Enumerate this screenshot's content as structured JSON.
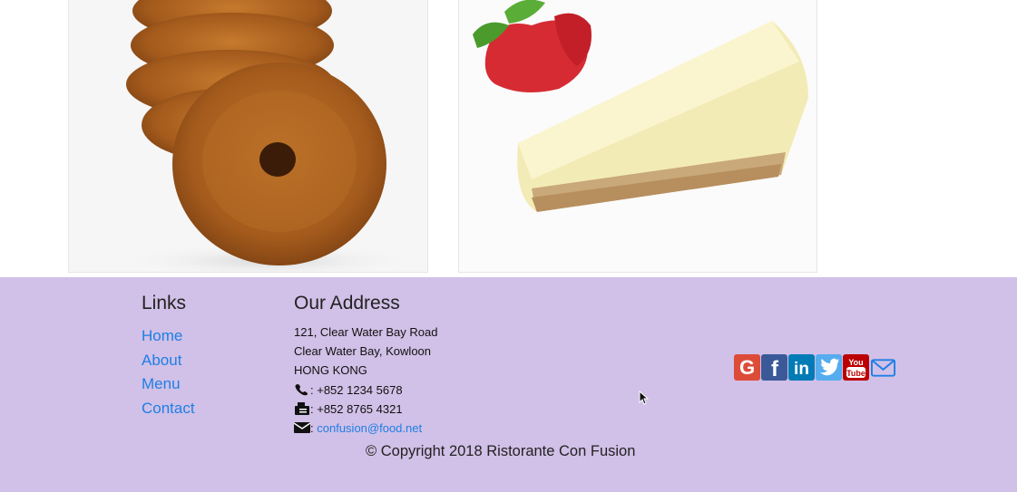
{
  "cards": [
    {
      "name": "donut",
      "alt": ""
    },
    {
      "name": "cheesecake",
      "alt": ""
    }
  ],
  "footer": {
    "links_heading": "Links",
    "links": [
      "Home",
      "About",
      "Menu",
      "Contact"
    ],
    "address_heading": "Our Address",
    "address_lines": [
      "121, Clear Water Bay Road",
      "Clear Water Bay, Kowloon",
      "HONG KONG"
    ],
    "phone": ": +852 1234 5678",
    "fax": ": +852 8765 4321",
    "email_prefix": ":",
    "email": "confusion@food.net",
    "social": [
      {
        "name": "google-plus-icon",
        "color": "#dd4b39"
      },
      {
        "name": "facebook-icon",
        "color": "#3b5998"
      },
      {
        "name": "linkedin-icon",
        "color": "#007bb6"
      },
      {
        "name": "twitter-icon",
        "color": "#55acee"
      },
      {
        "name": "youtube-icon",
        "color": "#bb0000"
      },
      {
        "name": "mail-icon",
        "color": "#1e7fe6"
      }
    ],
    "copyright": "© Copyright 2018 Ristorante Con Fusion",
    "background": "#d1c0e7",
    "link_color": "#1e7fe6"
  }
}
